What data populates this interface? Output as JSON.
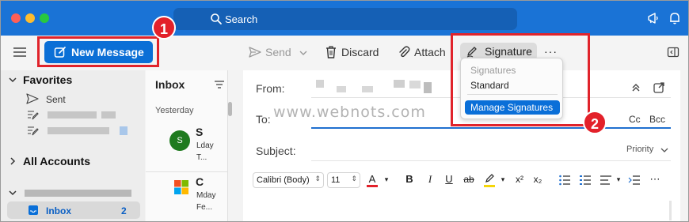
{
  "titlebar": {
    "search_label": "Search",
    "icons": [
      "megaphone-icon",
      "bell-icon"
    ],
    "colors": {
      "bar": "#1a73d6",
      "close": "#fe5f57",
      "minimize": "#febc2e",
      "zoom": "#28c840"
    }
  },
  "toolbar": {
    "new_message_label": "New Message",
    "send_label": "Send",
    "discard_label": "Discard",
    "attach_label": "Attach",
    "signature_label": "Signature",
    "more_label": "···"
  },
  "sidebar": {
    "favorites_label": "Favorites",
    "sent_label": "Sent",
    "all_accounts_label": "All Accounts",
    "inbox_label": "Inbox",
    "inbox_count": "2"
  },
  "message_list": {
    "title": "Inbox",
    "date_group": "Yesterday",
    "messages": [
      {
        "avatar": "S",
        "initial": "S",
        "line1": "Lday",
        "line2": "T..."
      },
      {
        "avatar": "",
        "initial": "C",
        "line1": "Mday",
        "line2": "Fe..."
      }
    ]
  },
  "compose": {
    "from_label": "From:",
    "to_label": "To:",
    "subject_label": "Subject:",
    "cc_label": "Cc",
    "bcc_label": "Bcc",
    "priority_label": "Priority",
    "watermark": "www.webnots.com"
  },
  "format_bar": {
    "font_name": "Calibri (Body)",
    "font_size": "11",
    "bold": "B",
    "italic": "I",
    "underline": "U",
    "strike": "ab",
    "superscript": "x²",
    "subscript": "x₂"
  },
  "signature_menu": {
    "header": "Signatures",
    "item_standard": "Standard",
    "item_manage": "Manage Signatures"
  },
  "annotations": {
    "badge1": "1",
    "badge2": "2",
    "color": "#e0232b"
  }
}
